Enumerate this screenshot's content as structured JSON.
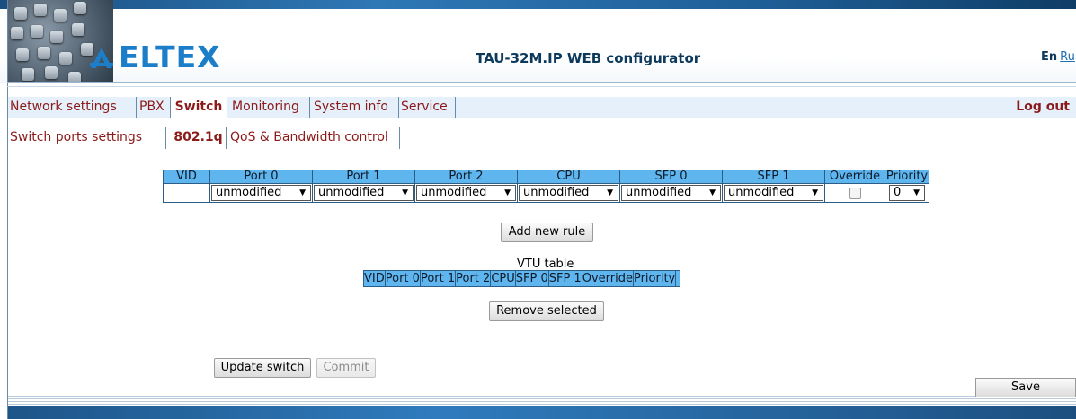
{
  "header": {
    "brand": "ELTEX",
    "title": "TAU-32M.IP WEB configurator",
    "lang_en": "En",
    "lang_ru": "Ru"
  },
  "menu": {
    "tabs": [
      {
        "label": "Network settings"
      },
      {
        "label": "PBX"
      },
      {
        "label": "Switch",
        "active": true
      },
      {
        "label": "Monitoring"
      },
      {
        "label": "System info"
      },
      {
        "label": "Service"
      }
    ],
    "logout": "Log out"
  },
  "submenu": {
    "tabs": [
      {
        "label": "Switch ports settings"
      },
      {
        "label": "802.1q",
        "active": true
      },
      {
        "label": "QoS & Bandwidth control"
      }
    ]
  },
  "rule_table": {
    "headers": [
      "VID",
      "Port 0",
      "Port 1",
      "Port 2",
      "CPU",
      "SFP 0",
      "SFP 1",
      "Override",
      "Priority"
    ],
    "vid_value": "",
    "port_selects": [
      "unmodified",
      "unmodified",
      "unmodified",
      "unmodified",
      "unmodified",
      "unmodified"
    ],
    "override_checked": false,
    "priority": "0"
  },
  "buttons": {
    "add_rule": "Add new rule",
    "remove_selected": "Remove selected",
    "update_switch": "Update switch",
    "commit": "Commit",
    "save": "Save"
  },
  "vtu": {
    "caption": "VTU table",
    "headers": [
      "VID",
      "Port 0",
      "Port 1",
      "Port 2",
      "CPU",
      "SFP 0",
      "SFP 1",
      "Override",
      "Priority",
      ""
    ]
  },
  "colors": {
    "brand_blue": "#1c7ec8",
    "menu_text": "#8b1a1a",
    "table_header": "#5fb5ee"
  }
}
